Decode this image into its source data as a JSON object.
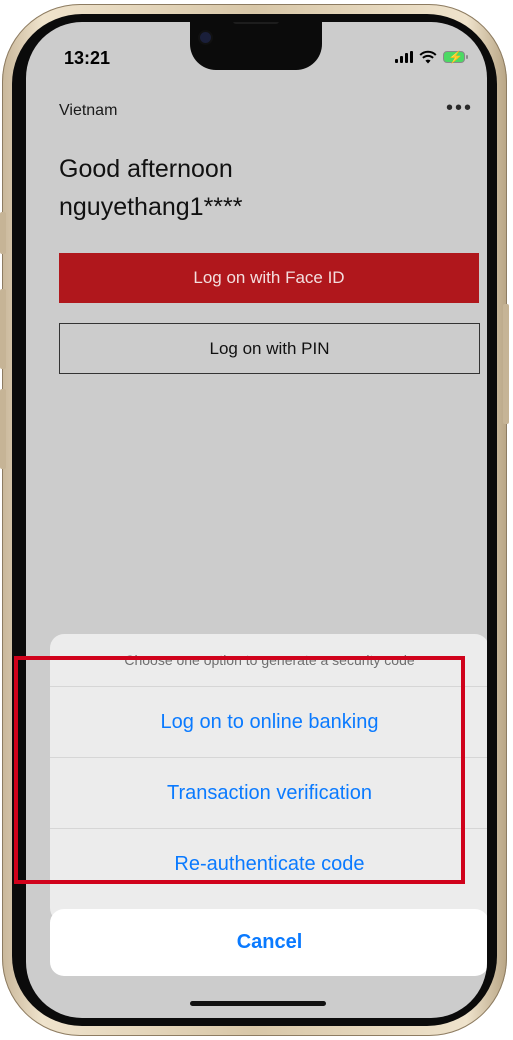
{
  "status_bar": {
    "time": "13:21"
  },
  "header": {
    "region": "Vietnam",
    "more_icon": "more-horizontal-icon",
    "more_glyph": "•••"
  },
  "greeting": {
    "line1": "Good afternoon",
    "line2": "nguyethang1****"
  },
  "buttons": {
    "face_id": "Log on with Face ID",
    "pin": "Log on with PIN"
  },
  "action_sheet": {
    "title": "Choose one option to generate a security code",
    "options": [
      "Log on to online banking",
      "Transaction verification",
      "Re-authenticate code"
    ],
    "cancel": "Cancel"
  },
  "colors": {
    "brand_red": "#b0171c",
    "ios_blue": "#0a7aff",
    "highlight": "#d0021b",
    "background": "#cccccc"
  }
}
